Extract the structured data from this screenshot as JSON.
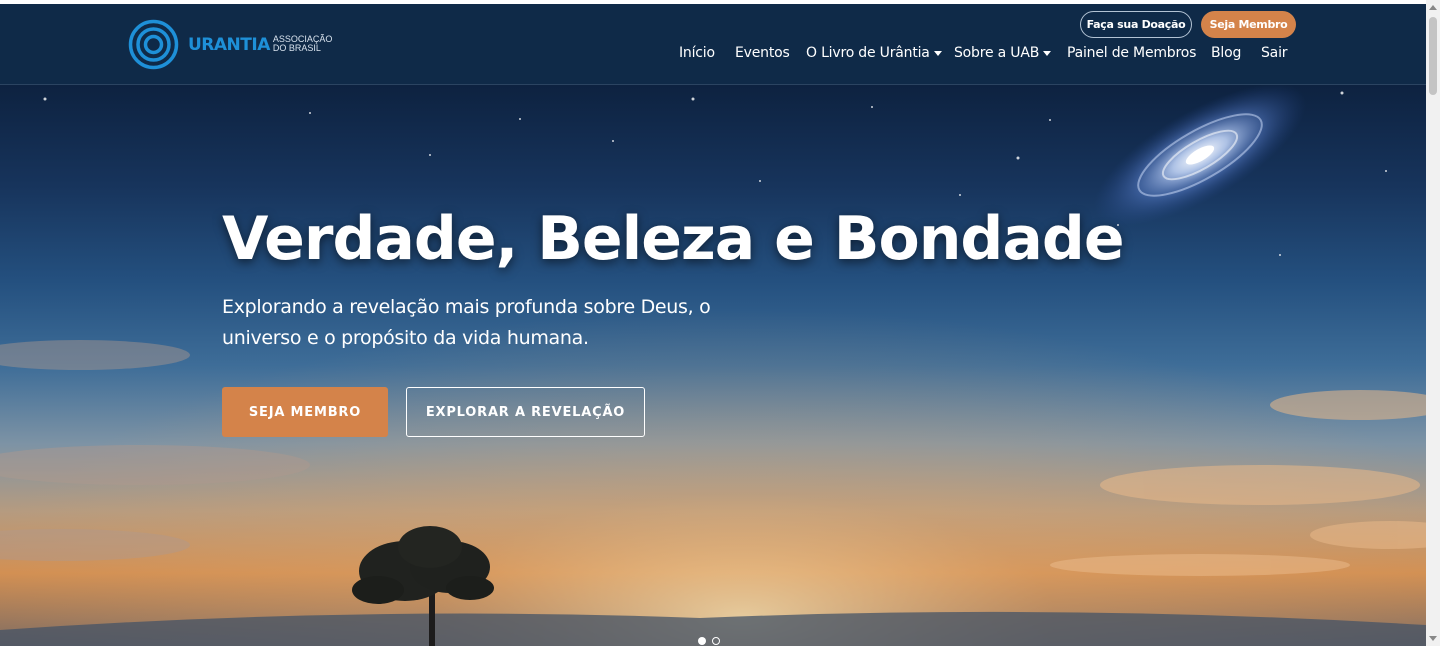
{
  "logo": {
    "word": "URANTIA",
    "sub_line1": "ASSOCIAÇÃO",
    "sub_line2": "DO BRASIL",
    "icon": "concentric-circles-icon"
  },
  "header": {
    "donate_label": "Faça sua Doação",
    "member_label": "Seja Membro",
    "nav": [
      {
        "label": "Início",
        "dropdown": false
      },
      {
        "label": "Eventos",
        "dropdown": false
      },
      {
        "label": "O Livro de Urântia",
        "dropdown": true
      },
      {
        "label": "Sobre a UAB",
        "dropdown": true
      },
      {
        "label": "Painel de Membros",
        "dropdown": false
      },
      {
        "label": "Blog",
        "dropdown": false
      },
      {
        "label": "Sair",
        "dropdown": false
      }
    ]
  },
  "hero": {
    "title": "Verdade, Beleza e Bondade",
    "subtitle": "Explorando a revelação mais profunda sobre Deus, o universo e o propósito da vida humana.",
    "cta_primary": "SEJA MEMBRO",
    "cta_secondary": "EXPLORAR A REVELAÇÃO",
    "slides_total": 2,
    "slide_active": 1
  },
  "colors": {
    "navbar": "#0f2a48",
    "accent": "#d4834a",
    "logo_blue": "#1e90d8"
  }
}
